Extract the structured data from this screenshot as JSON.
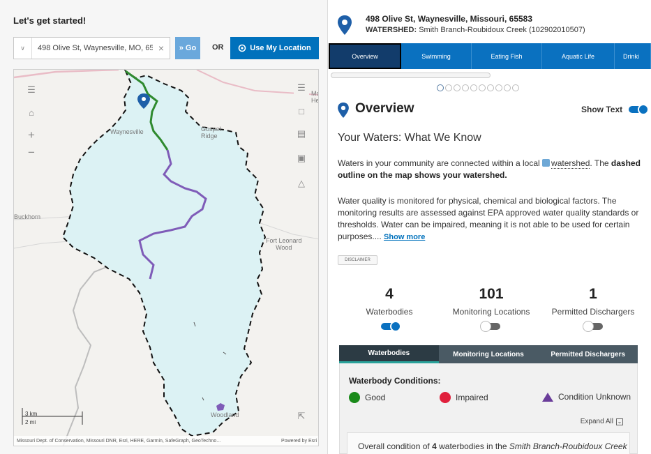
{
  "search": {
    "heading": "Let's get started!",
    "value": "498 Olive St, Waynesville, MO, 65",
    "go_label": "Go",
    "or_label": "OR",
    "location_label": "Use My Location"
  },
  "map": {
    "labels": {
      "waynesville": "Waynesville",
      "gospel": "Gospel",
      "ridge": "Ridge",
      "buckhorn": "Buckhorn",
      "fort1": "Fort Leonard",
      "fort2": "Wood",
      "woodland": "Woodland",
      "mc1": "Mc",
      "mc2": "He"
    },
    "scale_km": "3 km",
    "scale_mi": "2 mi",
    "attribution": "Missouri Dept. of Conservation, Missouri DNR, Esri, HERE, Garmin, SafeGraph, GeoTechno...",
    "powered_by": "Powered by Esri"
  },
  "location": {
    "address": "498 Olive St, Waynesville, Missouri, 65583",
    "watershed_label": "WATERSHED:",
    "watershed_name": "Smith Branch-Roubidoux Creek (102902010507)"
  },
  "tabs": [
    {
      "label": "Overview"
    },
    {
      "label": "Swimming"
    },
    {
      "label": "Eating Fish"
    },
    {
      "label": "Aquatic Life"
    },
    {
      "label": "Drinki"
    }
  ],
  "overview": {
    "title": "Overview",
    "show_text_label": "Show Text",
    "show_text_on": true,
    "subheading": "Your Waters: What We Know",
    "p1_pre": "Waters in your community are connected within a local",
    "p1_link": "watershed",
    "p1_post": ". The",
    "p1_bold": "dashed outline on the map shows your watershed.",
    "p2": "Water quality is monitored for physical, chemical and biological factors. The monitoring results are assessed against EPA approved water quality standards or thresholds. Water can be impaired, meaning it is not able to be used for certain purposes....",
    "show_more": "Show more",
    "disclaimer": "DISCLAIMER"
  },
  "stats": [
    {
      "value": "4",
      "label": "Waterbodies",
      "toggle_on": true
    },
    {
      "value": "101",
      "label": "Monitoring Locations",
      "toggle_on": false
    },
    {
      "value": "1",
      "label": "Permitted Dischargers",
      "toggle_on": false
    }
  ],
  "subtabs": [
    {
      "label": "Waterbodies"
    },
    {
      "label": "Monitoring Locations"
    },
    {
      "label": "Permitted Dischargers"
    }
  ],
  "conditions": {
    "title": "Waterbody Conditions:",
    "good": "Good",
    "impaired": "Impaired",
    "unknown": "Condition Unknown",
    "expand_all": "Expand All",
    "overall_pre": "Overall condition of",
    "overall_count": "4",
    "overall_mid": "waterbodies in the",
    "overall_name": "Smith Branch-Roubidoux Creek"
  },
  "colors": {
    "primary": "#0071bc",
    "tab_bar": "#0a71c0",
    "tab_active": "#123c6b",
    "good": "#1a8a1a",
    "impaired": "#e0203c",
    "unknown": "#6a3d9a",
    "watershed_fill": "#dcf2f4"
  }
}
